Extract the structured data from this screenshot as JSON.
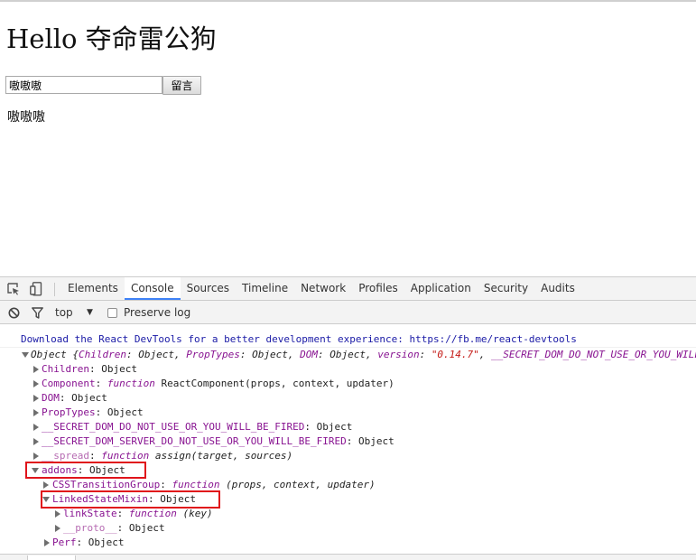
{
  "page": {
    "title": "Hello 夺命雷公狗",
    "input_value": "嗷嗷嗷",
    "button_label": "留言",
    "output_text": "嗷嗷嗷"
  },
  "devtools": {
    "tabs": [
      "Elements",
      "Console",
      "Sources",
      "Timeline",
      "Network",
      "Profiles",
      "Application",
      "Security",
      "Audits"
    ],
    "active_tab": "Console",
    "toolbar": {
      "context": "top",
      "preserve_log_label": "Preserve log"
    },
    "console": {
      "info_message": "Download the React DevTools for a better development experience: https://fb.me/react-devtools",
      "object_summary": {
        "prefix": "Object {",
        "children_k": "Children",
        "children_v": "Object",
        "proptypes_k": "PropTypes",
        "proptypes_v": "Object",
        "dom_k": "DOM",
        "dom_v": "Object",
        "version_k": "version",
        "version_v": "\"0.14.7\"",
        "secret_k": "__SECRET_DOM_DO_NOT_USE_OR_YOU_WILL"
      },
      "rows": {
        "children": {
          "key": "Children",
          "value": "Object"
        },
        "component": {
          "key": "Component",
          "fn": "function",
          "sig": "ReactComponent(props, context, updater)"
        },
        "dom": {
          "key": "DOM",
          "value": "Object"
        },
        "proptypes": {
          "key": "PropTypes",
          "value": "Object"
        },
        "secret_dom": {
          "key": "__SECRET_DOM_DO_NOT_USE_OR_YOU_WILL_BE_FIRED",
          "value": "Object"
        },
        "secret_server": {
          "key": "__SECRET_DOM_SERVER_DO_NOT_USE_OR_YOU_WILL_BE_FIRED",
          "value": "Object"
        },
        "spread": {
          "key": "__spread",
          "fn": "function",
          "sig": "assign(target, sources)"
        },
        "addons": {
          "key": "addons",
          "value": "Object"
        },
        "csstransition": {
          "key": "CSSTransitionGroup",
          "fn": "function",
          "sig": "(props, context, updater)"
        },
        "linkedstate": {
          "key": "LinkedStateMixin",
          "value": "Object"
        },
        "linkstate": {
          "key": "linkState",
          "fn": "function",
          "sig": "(key)"
        },
        "proto": {
          "key": "__proto__",
          "value": "Object"
        },
        "perf": {
          "key": "Perf",
          "value": "Object"
        }
      }
    }
  },
  "colors": {
    "highlight_box": "#e0141b",
    "active_tab_underline": "#3e82f7",
    "console_key": "#881391",
    "console_info": "#1a1aa6",
    "console_string": "#c41a16"
  }
}
